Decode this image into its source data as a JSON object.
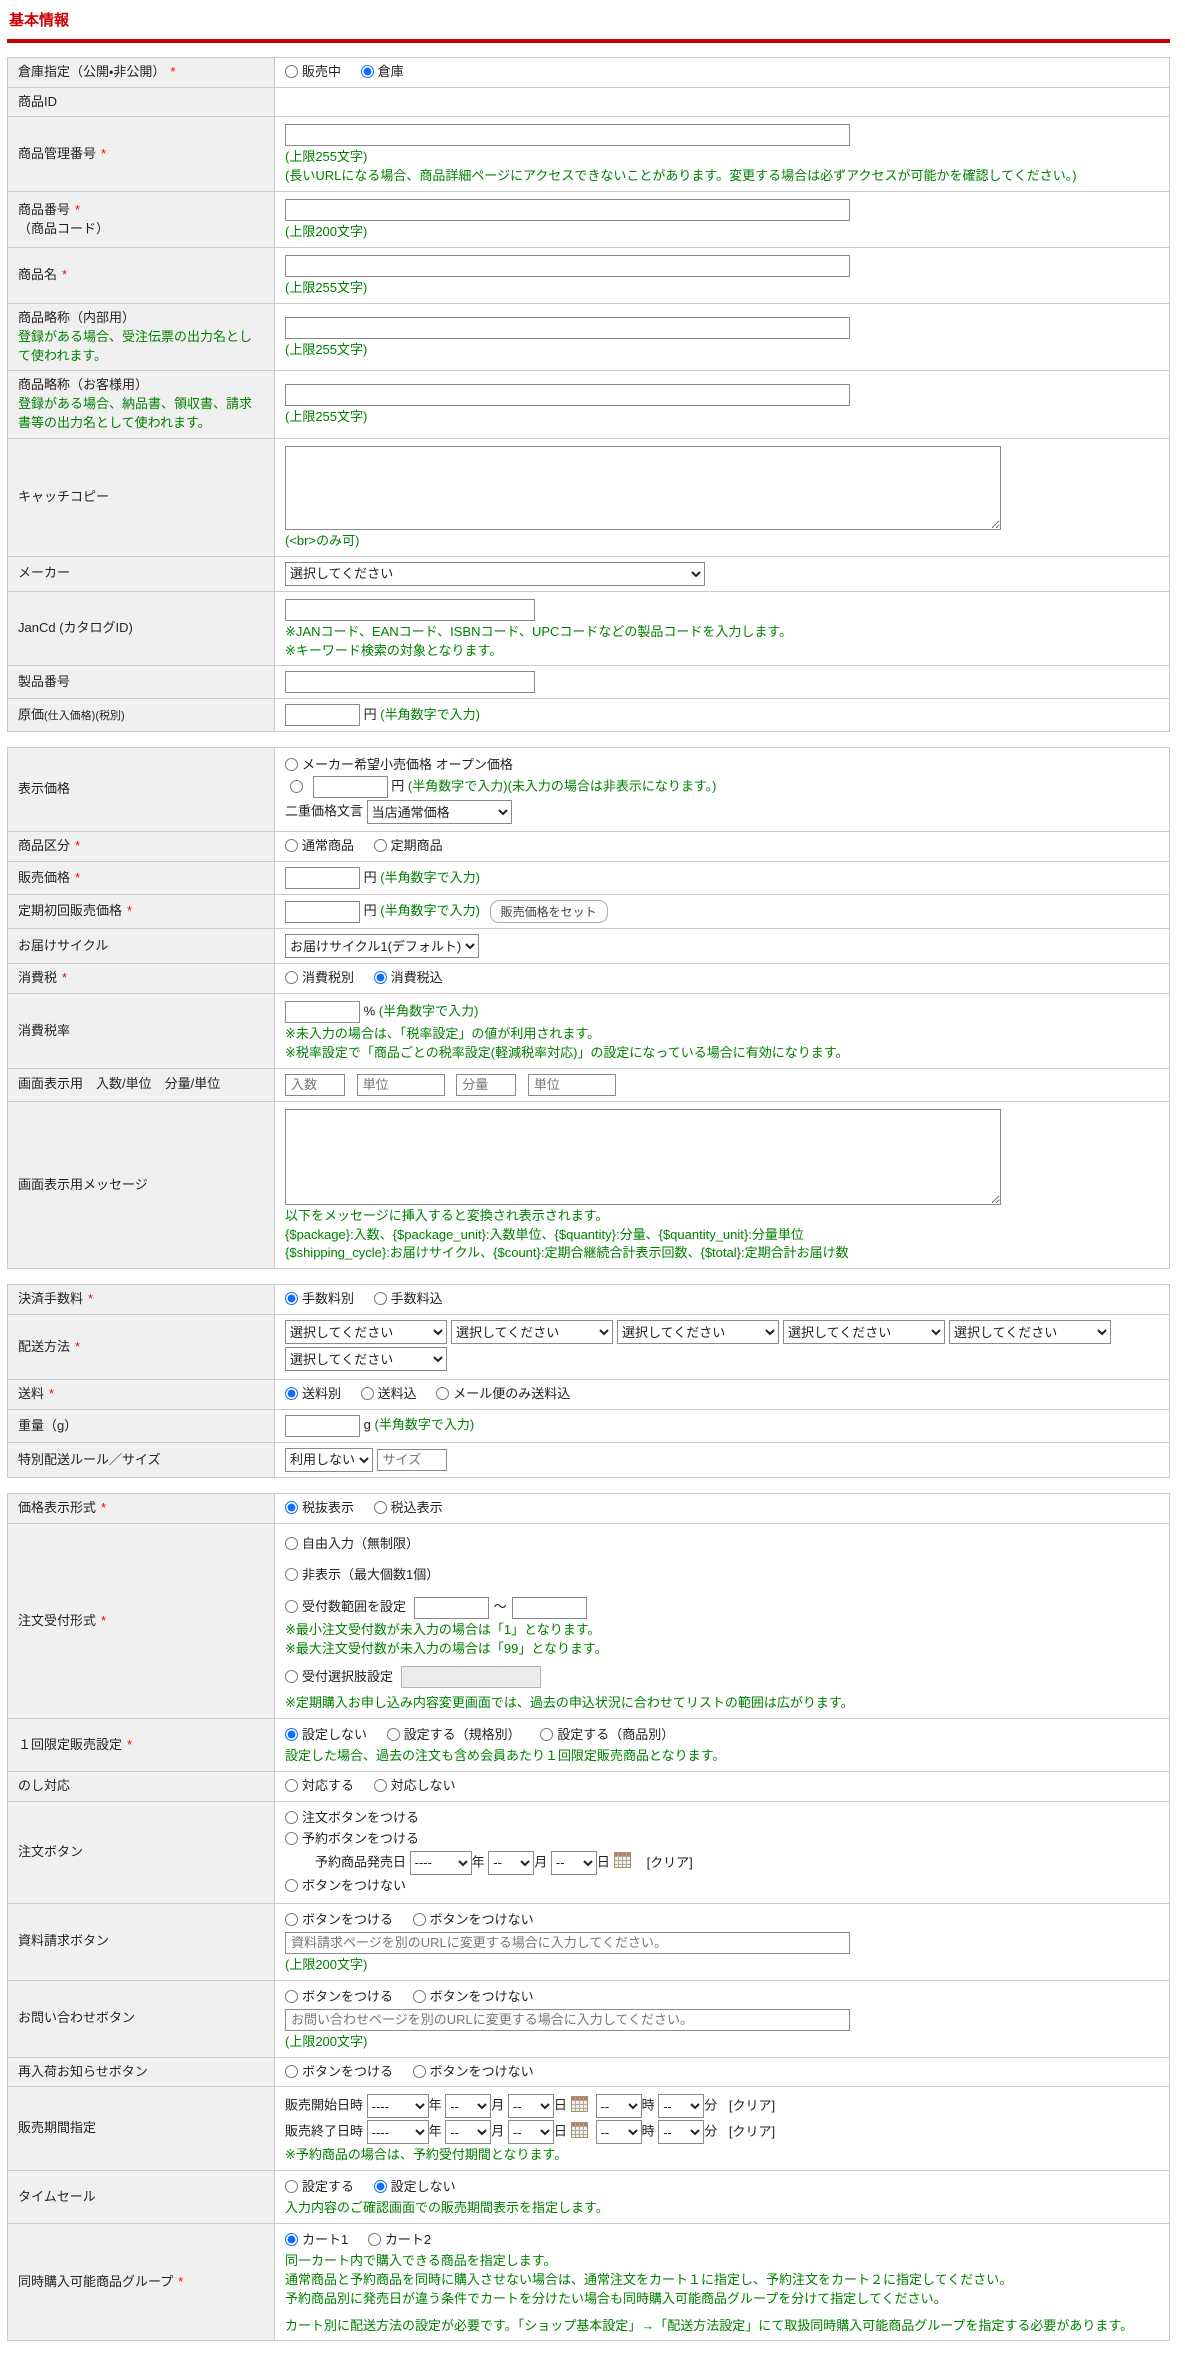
{
  "page": {
    "title": "基本情報"
  },
  "common": {
    "required": "*",
    "select_ph": "選択してください",
    "num_input": "(半角数字で入力)",
    "yen": "円",
    "percent": "%",
    "g": "g",
    "year": "年",
    "month": "月",
    "day": "日",
    "hour": "時",
    "minute": "分",
    "clear": "[クリア]",
    "tilde": "～",
    "btn_on": "ボタンをつける",
    "btn_off": "ボタンをつけない",
    "year_ph": "----",
    "md_ph": "--"
  },
  "basic": {
    "warehouse": {
      "label": "倉庫指定（公開・非公開）",
      "options": [
        "販売中",
        "倉庫"
      ],
      "selected": "倉庫"
    },
    "product_id": {
      "label": "商品ID"
    },
    "admin_number": {
      "label": "商品管理番号",
      "limit": "(上限255文字)",
      "url_note": "(長いURLになる場合、商品詳細ページにアクセスできないことがあります。変更する場合は必ずアクセスが可能かを確認してください。)"
    },
    "item_number": {
      "label": "商品番号",
      "label2": "（商品コード）",
      "limit": "(上限200文字)"
    },
    "name": {
      "label": "商品名",
      "limit": "(上限255文字)"
    },
    "short_internal": {
      "label": "商品略称（内部用）",
      "desc": "登録がある場合、受注伝票の出力名として使われます。",
      "limit": "(上限255文字)"
    },
    "short_customer": {
      "label": "商品略称（お客様用）",
      "desc": "登録がある場合、納品書、領収書、請求書等の出力名として使われます。",
      "limit": "(上限255文字)"
    },
    "catch_copy": {
      "label": "キャッチコピー",
      "note": "(<br>のみ可)"
    },
    "maker": {
      "label": "メーカー",
      "value": "選択してください"
    },
    "jancd": {
      "label": "JanCd (カタログID)",
      "note1": "※JANコード、EANコード、ISBNコード、UPCコードなどの製品コードを入力します。",
      "note2": "※キーワード検索の対象となります。"
    },
    "product_number": {
      "label": "製品番号"
    },
    "cost": {
      "label": "原価",
      "label_small": "(仕入価格)(税別)"
    }
  },
  "price": {
    "display_price": {
      "label": "表示価格",
      "opt1": "メーカー希望小売価格 オープン価格",
      "opt2_note": "(未入力の場合は非表示になります。)",
      "dual_label": "二重価格文言",
      "dual_value": "当店通常価格"
    },
    "category": {
      "label": "商品区分",
      "options": [
        "通常商品",
        "定期商品"
      ]
    },
    "selling": {
      "label": "販売価格"
    },
    "first_selling": {
      "label": "定期初回販売価格",
      "button": "販売価格をセット"
    },
    "cycle": {
      "label": "お届けサイクル",
      "value": "お届けサイクル1(デフォルト)"
    },
    "tax": {
      "label": "消費税",
      "options": [
        "消費税別",
        "消費税込"
      ],
      "selected": "消費税込"
    },
    "tax_rate": {
      "label": "消費税率",
      "note1": "※未入力の場合は、「税率設定」の値が利用されます。",
      "note2": "※税率設定で「商品ごとの税率設定(軽減税率対応)」の設定になっている場合に有効になります。"
    },
    "display_units": {
      "label": "画面表示用　入数/単位　分量/単位",
      "ph1": "入数",
      "ph2": "単位",
      "ph3": "分量",
      "ph4": "単位"
    },
    "display_message": {
      "label": "画面表示用メッセージ",
      "note1": "以下をメッセージに挿入すると変換され表示されます。",
      "note2": "{$package}:入数、{$package_unit}:入数単位、{$quantity}:分量、{$quantity_unit}:分量単位",
      "note3": "{$shipping_cycle}:お届けサイクル、{$count}:定期合継続合計表示回数、{$total}:定期合計お届け数"
    }
  },
  "shipping": {
    "fee": {
      "label": "決済手数料",
      "options": [
        "手数料別",
        "手数料込"
      ],
      "selected": "手数料別"
    },
    "method": {
      "label": "配送方法",
      "select_ph": "選択してください"
    },
    "postage": {
      "label": "送料",
      "options": [
        "送料別",
        "送料込",
        "メール便のみ送料込"
      ],
      "selected": "送料別"
    },
    "weight": {
      "label": "重量（g）"
    },
    "special": {
      "label": "特別配送ルール／サイズ",
      "select_value": "利用しない",
      "input_ph": "サイズ"
    }
  },
  "order": {
    "price_display": {
      "label": "価格表示形式",
      "options": [
        "税抜表示",
        "税込表示"
      ],
      "selected": "税抜表示"
    },
    "order_format": {
      "label": "注文受付形式",
      "opt1": "自由入力（無制限）",
      "opt2": "非表示（最大個数1個）",
      "opt3": "受付数範囲を設定",
      "note1": "※最小注文受付数が未入力の場合は「1」となります。",
      "note2": "※最大注文受付数が未入力の場合は「99」となります。",
      "opt4": "受付選択肢設定",
      "note3": "※定期購入お申し込み内容変更画面では、過去の申込状況に合わせてリストの範囲は広がります。"
    },
    "once_limit": {
      "label": "１回限定販売設定",
      "options": [
        "設定しない",
        "設定する（規格別）",
        "設定する（商品別）"
      ],
      "selected": "設定しない",
      "note": "設定した場合、過去の注文も含め会員あたり１回限定販売商品となります。"
    },
    "noshi": {
      "label": "のし対応",
      "options": [
        "対応する",
        "対応しない"
      ]
    },
    "order_button": {
      "label": "注文ボタン",
      "opt1": "注文ボタンをつける",
      "opt2": "予約ボタンをつける",
      "release_label": "予約商品発売日",
      "opt3": "ボタンをつけない"
    },
    "request_button": {
      "label": "資料請求ボタン",
      "ph": "資料請求ページを別のURLに変更する場合に入力してください。",
      "limit": "(上限200文字)"
    },
    "contact_button": {
      "label": "お問い合わせボタン",
      "ph": "お問い合わせページを別のURLに変更する場合に入力してください。",
      "limit": "(上限200文字)"
    },
    "restock_button": {
      "label": "再入荷お知らせボタン"
    },
    "sale_period": {
      "label": "販売期間指定",
      "start_label": "販売開始日時",
      "end_label": "販売終了日時",
      "note": "※予約商品の場合は、予約受付期間となります。"
    },
    "time_sale": {
      "label": "タイムセール",
      "options": [
        "設定する",
        "設定しない"
      ],
      "selected": "設定しない",
      "note": "入力内容のご確認画面での販売期間表示を指定します。"
    },
    "group": {
      "label": "同時購入可能商品グループ",
      "options": [
        "カート1",
        "カート2"
      ],
      "selected": "カート1",
      "note1": "同一カート内で購入できる商品を指定します。",
      "note2": "通常商品と予約商品を同時に購入させない場合は、通常注文をカート１に指定し、予約注文をカート２に指定してください。",
      "note3": "予約商品別に発売日が違う条件でカートを分けたい場合も同時購入可能商品グループを分けて指定してください。",
      "note4": "カート別に配送方法の設定が必要です。「ショップ基本設定」→「配送方法設定」にて取扱同時購入可能商品グループを指定する必要があります。"
    }
  }
}
